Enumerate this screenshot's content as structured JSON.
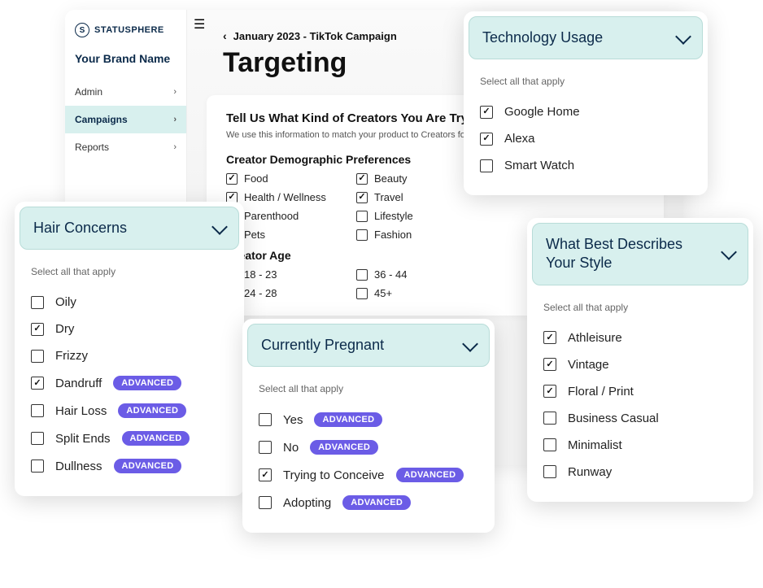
{
  "brand": {
    "logo_text": "STATUSPHERE",
    "brand_name": "Your Brand Name",
    "logo_letter": "S"
  },
  "sidebar": {
    "items": [
      {
        "label": "Admin",
        "active": false
      },
      {
        "label": "Campaigns",
        "active": true
      },
      {
        "label": "Reports",
        "active": false
      }
    ]
  },
  "breadcrumb": "January 2023 - TikTok Campaign",
  "page_title": "Targeting",
  "card": {
    "heading": "Tell Us What Kind of Creators You Are Trying to Reach",
    "sub": "We use this information to match your product to Creators for the best fit."
  },
  "demo": {
    "title": "Creator Demographic Preferences",
    "left": [
      {
        "label": "Food",
        "checked": true
      },
      {
        "label": "Health / Wellness",
        "checked": true
      },
      {
        "label": "Parenthood",
        "checked": false
      },
      {
        "label": "Pets",
        "checked": false
      }
    ],
    "right": [
      {
        "label": "Beauty",
        "checked": true
      },
      {
        "label": "Travel",
        "checked": true
      },
      {
        "label": "Lifestyle",
        "checked": false
      },
      {
        "label": "Fashion",
        "checked": false
      }
    ]
  },
  "age": {
    "title": "Creator Age",
    "left": [
      {
        "label": "18 - 23",
        "checked": false
      },
      {
        "label": "24 - 28",
        "checked": false
      }
    ],
    "right": [
      {
        "label": "36 - 44",
        "checked": false
      },
      {
        "label": "45+",
        "checked": false
      }
    ]
  },
  "panels": {
    "hair": {
      "title": "Hair Concerns",
      "hint": "Select all that apply",
      "options": [
        {
          "label": "Oily",
          "checked": false,
          "advanced": false
        },
        {
          "label": "Dry",
          "checked": true,
          "advanced": false
        },
        {
          "label": "Frizzy",
          "checked": false,
          "advanced": false
        },
        {
          "label": "Dandruff",
          "checked": true,
          "advanced": true
        },
        {
          "label": "Hair Loss",
          "checked": false,
          "advanced": true
        },
        {
          "label": "Split Ends",
          "checked": false,
          "advanced": true
        },
        {
          "label": "Dullness",
          "checked": false,
          "advanced": true
        }
      ]
    },
    "tech": {
      "title": "Technology Usage",
      "hint": "Select all that apply",
      "options": [
        {
          "label": "Google Home",
          "checked": true,
          "advanced": false
        },
        {
          "label": "Alexa",
          "checked": true,
          "advanced": false
        },
        {
          "label": "Smart Watch",
          "checked": false,
          "advanced": false
        }
      ]
    },
    "pregnant": {
      "title": "Currently Pregnant",
      "hint": "Select all that apply",
      "options": [
        {
          "label": "Yes",
          "checked": false,
          "advanced": true
        },
        {
          "label": "No",
          "checked": false,
          "advanced": true
        },
        {
          "label": "Trying to Conceive",
          "checked": true,
          "advanced": true
        },
        {
          "label": "Adopting",
          "checked": false,
          "advanced": true
        }
      ]
    },
    "style": {
      "title": "What Best Describes Your Style",
      "hint": "Select all that apply",
      "options": [
        {
          "label": "Athleisure",
          "checked": true,
          "advanced": false
        },
        {
          "label": "Vintage",
          "checked": true,
          "advanced": false
        },
        {
          "label": "Floral / Print",
          "checked": true,
          "advanced": false
        },
        {
          "label": "Business Casual",
          "checked": false,
          "advanced": false
        },
        {
          "label": "Minimalist",
          "checked": false,
          "advanced": false
        },
        {
          "label": "Runway",
          "checked": false,
          "advanced": false
        }
      ]
    }
  },
  "badge_label": "ADVANCED"
}
